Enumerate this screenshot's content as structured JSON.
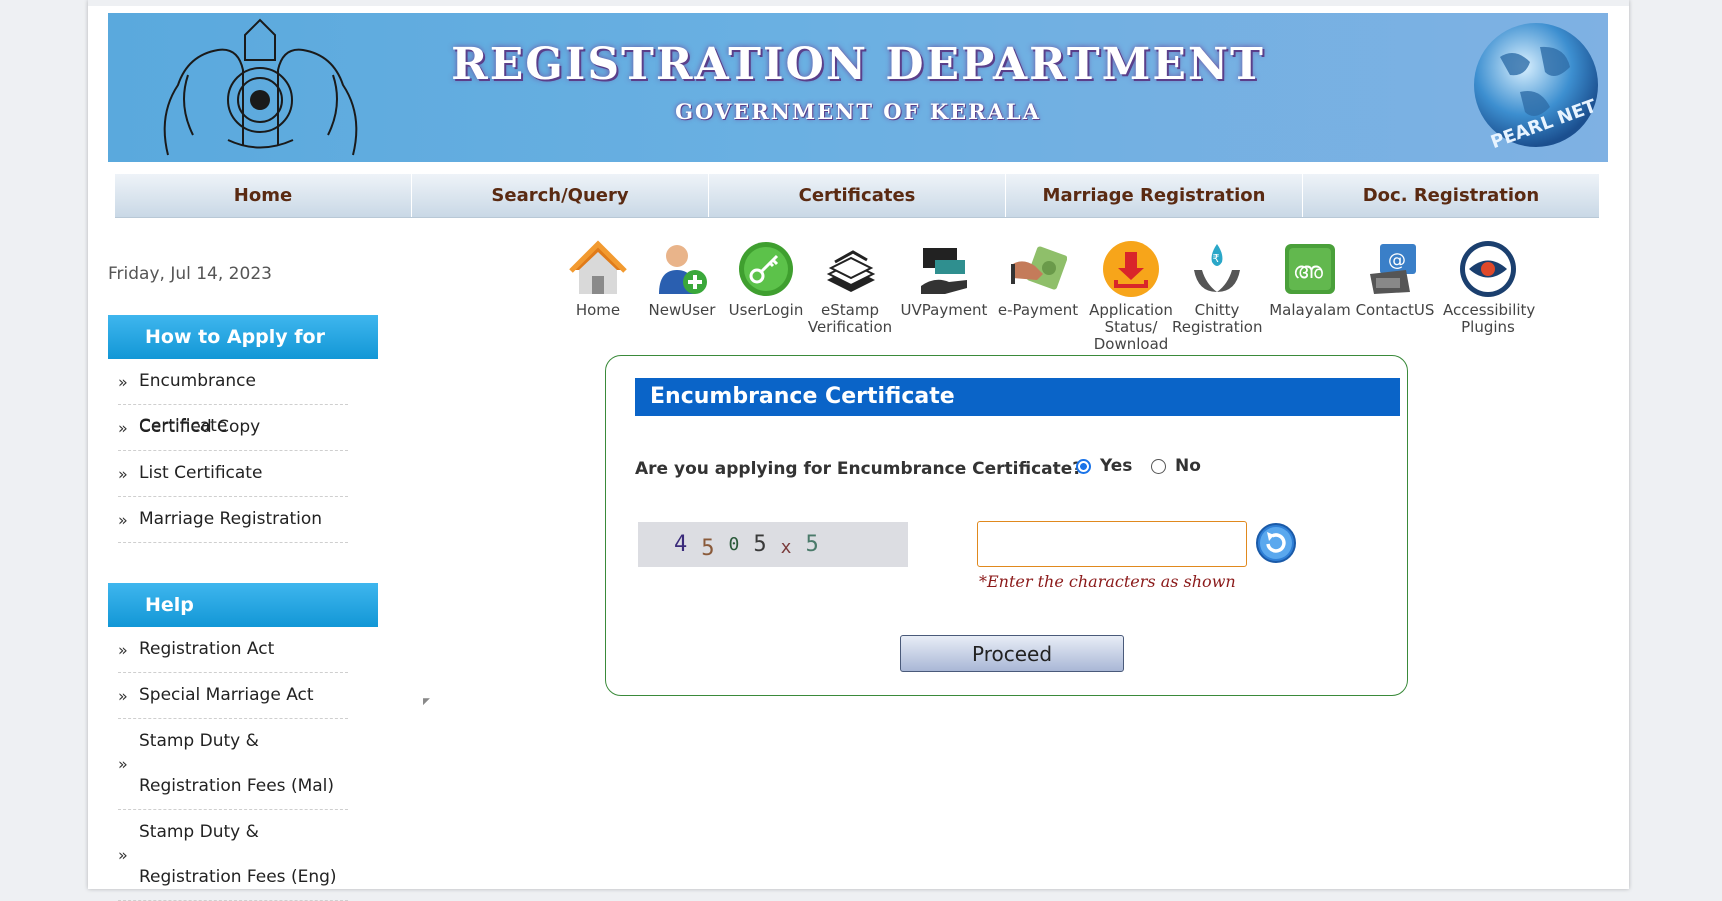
{
  "banner": {
    "title": "REGISTRATION DEPARTMENT",
    "subtitle": "GOVERNMENT OF KERALA",
    "left_logo_icon": "kerala-emblem-icon",
    "right_logo_icon": "pearl-net-globe-icon",
    "right_logo_text": "PEARL NET"
  },
  "nav": [
    "Home",
    "Search/Query",
    "Certificates",
    "Marriage Registration",
    "Doc. Registration"
  ],
  "date": "Friday, Jul 14, 2023",
  "sidebar": {
    "apply_title": "How to Apply for",
    "apply_items": [
      "Encumbrance Certificate",
      "Certified Copy",
      "List Certificate",
      "Marriage Registration"
    ],
    "help_title": "Help",
    "help_items": [
      "Registration Act",
      "Special Marriage Act",
      "Stamp Duty & Registration Fees (Mal)",
      "Stamp Duty & Registration Fees (Eng)"
    ]
  },
  "icons": [
    {
      "label": "Home",
      "icon": "home-icon"
    },
    {
      "label": "NewUser",
      "icon": "new-user-icon"
    },
    {
      "label": "UserLogin",
      "icon": "key-icon"
    },
    {
      "label": "eStamp Verification",
      "icon": "estamp-icon"
    },
    {
      "label": "UVPayment",
      "icon": "uv-payment-icon"
    },
    {
      "label": "e-Payment",
      "icon": "e-payment-icon"
    },
    {
      "label": "Application Status/ Download",
      "icon": "download-icon"
    },
    {
      "label": "Chitty Registration",
      "icon": "chitty-icon"
    },
    {
      "label": "Malayalam",
      "icon": "malayalam-icon"
    },
    {
      "label": "ContactUS",
      "icon": "contact-icon"
    },
    {
      "label": "Accessibility Plugins",
      "icon": "accessibility-eye-icon"
    }
  ],
  "form": {
    "title": "Encumbrance Certificate",
    "question": "Are you applying for Encumbrance Certificate?",
    "yes_label": "Yes",
    "no_label": "No",
    "selected": "Yes",
    "captcha_chars": [
      "4",
      "5",
      "0",
      "5",
      "x",
      "5"
    ],
    "captcha_colors": [
      "#3a2a7a",
      "#8a5a3a",
      "#2a5a3a",
      "#3a3a3a",
      "#7a3a3a",
      "#4a7a6a"
    ],
    "captcha_input_value": "",
    "hint": "*Enter the characters as shown",
    "proceed_label": "Proceed"
  },
  "colors": {
    "form_header": "#0a64c8",
    "sidebar_header": "#1297d6",
    "nav_text": "#5a2a12",
    "hint_text": "#8b1a1a"
  }
}
